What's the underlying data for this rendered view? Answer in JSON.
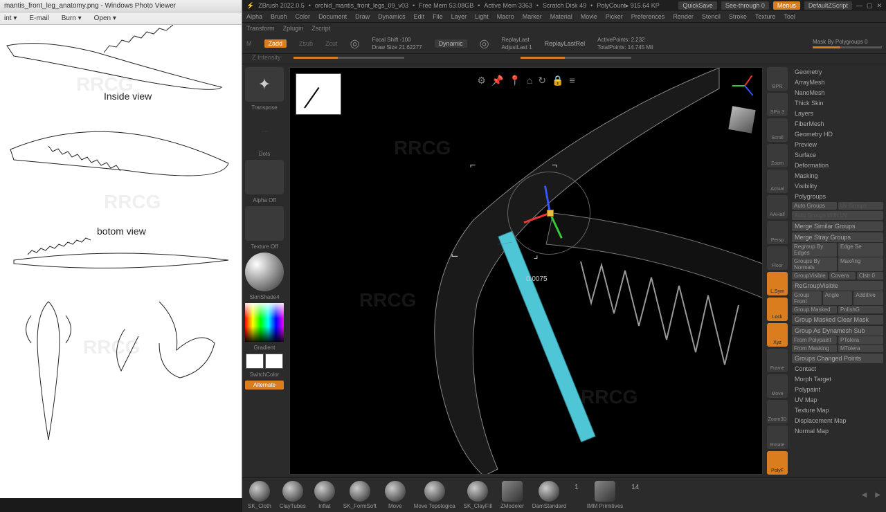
{
  "photoViewer": {
    "title": "mantis_front_leg_anatomy.png - Windows Photo Viewer",
    "menu": [
      "int ▾",
      "E-mail",
      "Burn ▾",
      "Open ▾"
    ],
    "labels": {
      "inside": "Inside view",
      "bottom": "botom view"
    }
  },
  "zbrush": {
    "title": {
      "app": "ZBrush 2022.0.5",
      "project": "orchid_mantis_front_legs_09_v03",
      "freeMem": "Free Mem 53.08GB",
      "activeMem": "Active Mem 3363",
      "scratch": "Scratch Disk 49",
      "polycount": "PolyCount▸ 915.64 KP",
      "quicksave": "QuickSave",
      "seeThrough": "See-through  0",
      "menus": "Menus",
      "default": "DefaultZScript"
    },
    "menubar": [
      "Alpha",
      "Brush",
      "Color",
      "Document",
      "Draw",
      "Dynamics",
      "Edit",
      "File",
      "Layer",
      "Light",
      "Macro",
      "Marker",
      "Material",
      "Movie",
      "Picker",
      "Preferences",
      "Render",
      "Stencil",
      "Stroke",
      "Texture",
      "Tool"
    ],
    "secondary": [
      "Transform",
      "Zplugin",
      "Zscript"
    ],
    "modeRow": {
      "m": "M",
      "zadd": "Zadd",
      "zsub": "Zsub",
      "zcut": "Zcut",
      "zint": "Z Intensity"
    },
    "sliders": {
      "focalShift": "Focal Shift -100",
      "drawSize": "Draw Size 21.62277",
      "dynamic": "Dynamic",
      "replayLast": "ReplayLast",
      "replayLastRel": "ReplayLastRel",
      "adjustLast": "AdjustLast 1",
      "activePoints": "ActivePoints: 2,232",
      "totalPoints": "TotalPoints: 14.745 Mil",
      "maskPoly": "Mask By Polygroups  0"
    },
    "leftTools": {
      "transpose": "Transpose",
      "dots": "Dots",
      "alphaOff": "Alpha Off",
      "textureOff": "Texture Off",
      "material": "SkinShade4",
      "gradient": "Gradient",
      "switchColor": "SwitchColor",
      "alternate": "Alternate"
    },
    "rightStrip": [
      "BPR",
      "SPix 3",
      "Scroll",
      "Zoom",
      "Actual",
      "AAHalf",
      "Persp",
      "Floor",
      "L.Sym",
      "Lock",
      "Xyz",
      "Frame",
      "Move",
      "Zoom3D",
      "Rotate",
      "PolyF"
    ],
    "rightPanel": {
      "items": [
        "Geometry",
        "ArrayMesh",
        "NanoMesh",
        "Thick Skin",
        "Layers",
        "FiberMesh",
        "Geometry HD",
        "Preview",
        "Surface",
        "Deformation",
        "Masking",
        "Visibility",
        "Polygroups"
      ],
      "pg": {
        "autoGroups": "Auto Groups",
        "uvGroups": "Uv Groups",
        "autoGroupsUV": "Auto Groups With UV",
        "mergeSimilar": "Merge Similar Groups",
        "mergeStray": "Merge Stray Groups",
        "regroupEdges": "Regroup By Edges",
        "edgeSe": "Edge Se",
        "groupsNormals": "Groups By Normals",
        "maxAng": "MaxAng",
        "groupVisible": "GroupVisible",
        "coverag": "Covera",
        "clstr": "Clstr 0",
        "regroupVisible": "ReGroupVisible",
        "groupFront": "Group Front",
        "angle": "Angle",
        "additive": "Additive",
        "groupMasked": "Group Masked",
        "polishG": "PolishG",
        "groupMaskedClear": "Group Masked Clear Mask",
        "groupDynamesh": "Group As Dynamesh Sub",
        "fromPolypaint": "From Polypaint",
        "ptolera": "PTolera",
        "fromMasking": "From Masking",
        "mtolera": "MTolera",
        "groupsChanged": "Groups Changed Points"
      },
      "below": [
        "Contact",
        "Morph Target",
        "Polypaint",
        "UV Map",
        "Texture Map",
        "Displacement Map",
        "Normal Map"
      ]
    },
    "viewport": {
      "measure": "0.0075"
    },
    "brushes": [
      "SK_Cloth",
      "ClayTubes",
      "Inflat",
      "SK_FormSoft",
      "Move",
      "Move Topologica",
      "SK_ClayFill",
      "ZModeler",
      "DamStandard",
      "IMM Primitives"
    ],
    "brushCounts": {
      "a": "1",
      "b": "14"
    }
  },
  "watermark": "RRCG"
}
